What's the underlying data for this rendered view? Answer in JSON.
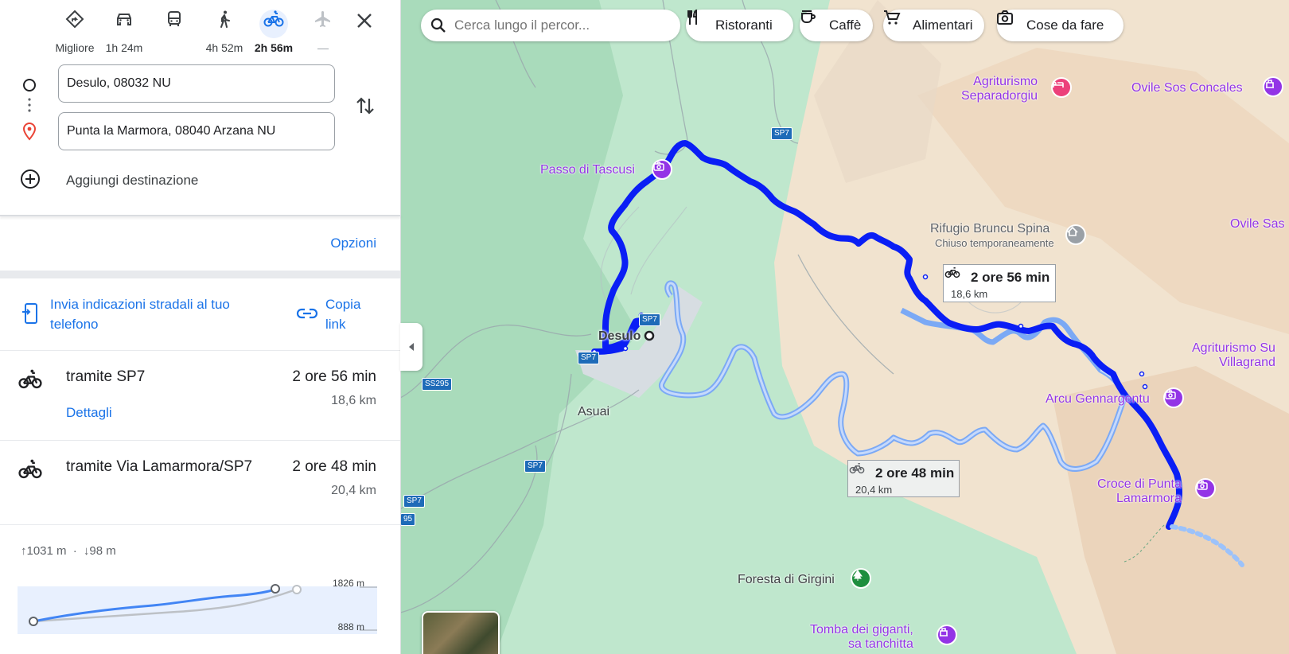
{
  "modes": [
    {
      "label": "Migliore",
      "icon": "best-route-icon"
    },
    {
      "label": "1h 24m",
      "icon": "car-icon"
    },
    {
      "label": "",
      "icon": "bus-icon"
    },
    {
      "label": "4h 52m",
      "icon": "walk-icon"
    },
    {
      "label": "2h 56m",
      "icon": "bike-icon",
      "active": true
    },
    {
      "label": "—",
      "icon": "plane-icon",
      "disabled": true
    }
  ],
  "origin": "Desulo, 08032 NU",
  "destination": "Punta la Marmora, 08040 Arzana NU",
  "add_destination": "Aggiungi destinazione",
  "options_label": "Opzioni",
  "send_phone_label": "Invia indicazioni stradali al tuo telefono",
  "copy_link_label": "Copia link",
  "routes": [
    {
      "via": "tramite SP7",
      "duration": "2 ore 56 min",
      "distance": "18,6 km",
      "details": "Dettagli"
    },
    {
      "via": "tramite Via Lamarmora/SP7",
      "duration": "2 ore 48 min",
      "distance": "20,4 km"
    }
  ],
  "elevation": {
    "ascent": "1031 m",
    "descent": "98 m",
    "max_label": "1826 m",
    "min_label": "888 m"
  },
  "map": {
    "search_placeholder": "Cerca lungo il percor...",
    "chips": [
      "Ristoranti",
      "Caffè",
      "Alimentari",
      "Cose da fare"
    ],
    "places": {
      "agriturismo_separadorgiu": [
        "Agriturismo",
        "Separadorgiu"
      ],
      "ovile_sos_concales": "Ovile Sos Concales",
      "passo_di_tascusi": "Passo di Tascusi",
      "rifugio_bruncu_spina": "Rifugio Bruncu Spina",
      "rifugio_status": "Chiuso temporaneamente",
      "ovile_sas": "Ovile Sas",
      "agriturismo_su_villagrande": [
        "Agriturismo Su",
        "Villagrand"
      ],
      "arcu_gennargentu": "Arcu Gennargentu",
      "croce_punta_lamarmora": [
        "Croce di Punta",
        "Lamarmora"
      ],
      "foresta_di_girgini": "Foresta di Girgini",
      "tomba_dei_giganti": [
        "Tomba dei giganti,",
        "sa tanchitta"
      ],
      "desulo": "Desulo",
      "asuai": "Asuai"
    },
    "road_tags": [
      "SP7",
      "SP7",
      "SP7",
      "SS295",
      "SP7",
      "SP7",
      "95"
    ],
    "route_main_label": {
      "duration": "2 ore 56 min",
      "distance": "18,6 km"
    },
    "route_alt_label": {
      "duration": "2 ore 48 min",
      "distance": "20,4 km"
    }
  },
  "colors": {
    "accent": "#1a73e8",
    "route_main": "#0a1ef5",
    "route_alt": "#8ab4f8",
    "poi": "#9334e6"
  }
}
